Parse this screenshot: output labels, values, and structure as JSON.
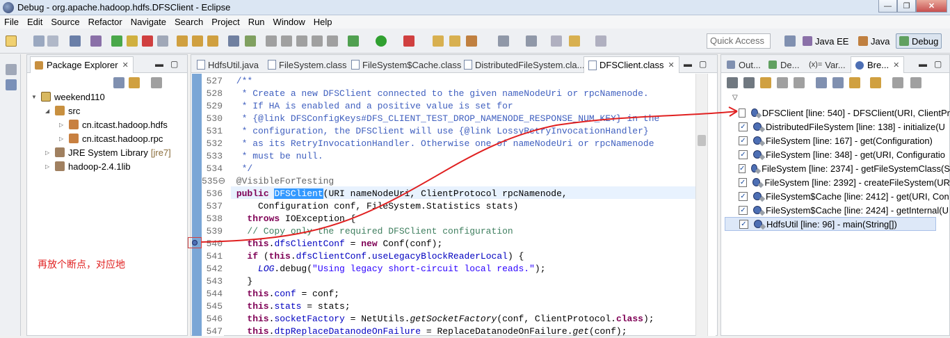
{
  "window": {
    "title": "Debug - org.apache.hadoop.hdfs.DFSClient - Eclipse",
    "minimize": "—",
    "maximize": "❐",
    "close": "✕"
  },
  "menu": [
    "File",
    "Edit",
    "Source",
    "Refactor",
    "Navigate",
    "Search",
    "Project",
    "Run",
    "Window",
    "Help"
  ],
  "quick_access": "Quick Access",
  "perspectives": [
    {
      "label": "Java EE"
    },
    {
      "label": "Java"
    },
    {
      "label": "Debug"
    }
  ],
  "package_explorer": {
    "tab_label": "Package Explorer",
    "close": "✕",
    "tree": [
      {
        "label": "weekend110",
        "expander": "▼"
      },
      {
        "label": "src",
        "expander": "◢"
      },
      {
        "label": "cn.itcast.hadoop.hdfs",
        "expander": "▷"
      },
      {
        "label": "cn.itcast.hadoop.rpc",
        "expander": "▷"
      },
      {
        "label": "JRE System Library",
        "decoration": "[jre7]",
        "expander": "▷"
      },
      {
        "label": "hadoop-2.4.1lib",
        "expander": "▷"
      }
    ]
  },
  "editor": {
    "tabs": [
      {
        "label": "HdfsUtil.java"
      },
      {
        "label": "FileSystem.class"
      },
      {
        "label": "FileSystem$Cache.class"
      },
      {
        "label": "DistributedFileSystem.cla..."
      },
      {
        "label": "DFSClient.class",
        "close": "✕"
      }
    ],
    "lines": [
      {
        "num": "527",
        "segments": [
          {
            "t": " /**",
            "c": "cm"
          }
        ]
      },
      {
        "num": "528",
        "segments": [
          {
            "t": "  * Create a new DFSClient connected to the given nameNodeUri or rpcNamenode.",
            "c": "cm"
          }
        ]
      },
      {
        "num": "529",
        "segments": [
          {
            "t": "  * If HA is enabled and a positive value is set for",
            "c": "cm"
          }
        ]
      },
      {
        "num": "530",
        "segments": [
          {
            "t": "  * {@link DFSConfigKeys#DFS_CLIENT_TEST_DROP_NAMENODE_RESPONSE_NUM_KEY} in the",
            "c": "cm"
          }
        ]
      },
      {
        "num": "531",
        "segments": [
          {
            "t": "  * configuration, the DFSClient will use {@link LossyRetryInvocationHandler}",
            "c": "cm"
          }
        ]
      },
      {
        "num": "532",
        "segments": [
          {
            "t": "  * as its RetryInvocationHandler. Otherwise one of nameNodeUri or rpcNamenode",
            "c": "cm"
          }
        ]
      },
      {
        "num": "533",
        "segments": [
          {
            "t": "  * must be null.",
            "c": "cm"
          }
        ]
      },
      {
        "num": "534",
        "segments": [
          {
            "t": "  */",
            "c": "cm"
          }
        ]
      },
      {
        "num": "535⊖",
        "segments": [
          {
            "t": " @VisibleForTesting",
            "c": "ann"
          }
        ]
      },
      {
        "num": "536",
        "segments": [
          {
            "t": " ",
            "c": ""
          },
          {
            "t": "public",
            "c": "kw"
          },
          {
            "t": " ",
            "c": ""
          },
          {
            "t": "DFSClient",
            "c": "sel"
          },
          {
            "t": "(URI nameNodeUri, ClientProtocol rpcNamenode,",
            "c": ""
          }
        ]
      },
      {
        "num": "537",
        "segments": [
          {
            "t": "     Configuration conf, FileSystem.Statistics stats)",
            "c": ""
          }
        ]
      },
      {
        "num": "538",
        "segments": [
          {
            "t": "   ",
            "c": ""
          },
          {
            "t": "throws",
            "c": "kw"
          },
          {
            "t": " IOException {",
            "c": ""
          }
        ]
      },
      {
        "num": "539",
        "segments": [
          {
            "t": "   // Copy only the required DFSClient configuration",
            "c": "cmg"
          }
        ]
      },
      {
        "num": "540",
        "segments": [
          {
            "t": "   ",
            "c": ""
          },
          {
            "t": "this",
            "c": "kw"
          },
          {
            "t": ".",
            "c": ""
          },
          {
            "t": "dfsClientConf",
            "c": "fld"
          },
          {
            "t": " = ",
            "c": ""
          },
          {
            "t": "new",
            "c": "kw"
          },
          {
            "t": " Conf(conf);",
            "c": ""
          }
        ]
      },
      {
        "num": "541",
        "segments": [
          {
            "t": "   ",
            "c": ""
          },
          {
            "t": "if",
            "c": "kw"
          },
          {
            "t": " (",
            "c": ""
          },
          {
            "t": "this",
            "c": "kw"
          },
          {
            "t": ".",
            "c": ""
          },
          {
            "t": "dfsClientConf",
            "c": "fld"
          },
          {
            "t": ".",
            "c": ""
          },
          {
            "t": "useLegacyBlockReaderLocal",
            "c": "fld"
          },
          {
            "t": ") {",
            "c": ""
          }
        ]
      },
      {
        "num": "542",
        "segments": [
          {
            "t": "     ",
            "c": ""
          },
          {
            "t": "LOG",
            "c": "fld it"
          },
          {
            "t": ".debug(",
            "c": ""
          },
          {
            "t": "\"Using legacy short-circuit local reads.\"",
            "c": "str"
          },
          {
            "t": ");",
            "c": ""
          }
        ]
      },
      {
        "num": "543",
        "segments": [
          {
            "t": "   }",
            "c": ""
          }
        ]
      },
      {
        "num": "544",
        "segments": [
          {
            "t": "   ",
            "c": ""
          },
          {
            "t": "this",
            "c": "kw"
          },
          {
            "t": ".",
            "c": ""
          },
          {
            "t": "conf",
            "c": "fld"
          },
          {
            "t": " = conf;",
            "c": ""
          }
        ]
      },
      {
        "num": "545",
        "segments": [
          {
            "t": "   ",
            "c": ""
          },
          {
            "t": "this",
            "c": "kw"
          },
          {
            "t": ".",
            "c": ""
          },
          {
            "t": "stats",
            "c": "fld"
          },
          {
            "t": " = stats;",
            "c": ""
          }
        ]
      },
      {
        "num": "546",
        "segments": [
          {
            "t": "   ",
            "c": ""
          },
          {
            "t": "this",
            "c": "kw"
          },
          {
            "t": ".",
            "c": ""
          },
          {
            "t": "socketFactory",
            "c": "fld"
          },
          {
            "t": " = NetUtils.",
            "c": ""
          },
          {
            "t": "getSocketFactory",
            "c": "it"
          },
          {
            "t": "(conf, ClientProtocol.",
            "c": ""
          },
          {
            "t": "class",
            "c": "kw"
          },
          {
            "t": ");",
            "c": ""
          }
        ]
      },
      {
        "num": "547",
        "segments": [
          {
            "t": "   ",
            "c": ""
          },
          {
            "t": "this",
            "c": "kw"
          },
          {
            "t": ".",
            "c": ""
          },
          {
            "t": "dtpReplaceDatanodeOnFailure",
            "c": "fld"
          },
          {
            "t": " = ReplaceDatanodeOnFailure.",
            "c": ""
          },
          {
            "t": "get",
            "c": "it"
          },
          {
            "t": "(conf);",
            "c": ""
          }
        ]
      }
    ]
  },
  "annotation": {
    "text": "再放个断点，对应地",
    "color": "#e02020"
  },
  "right_panel": {
    "tabs": [
      {
        "label": "Out..."
      },
      {
        "label": "De..."
      },
      {
        "label": "Var..."
      },
      {
        "label": "Bre...",
        "close": "✕"
      }
    ],
    "breakpoints": [
      {
        "label": "DFSClient [line: 540] - DFSClient(URI, ClientPr",
        "checked": false
      },
      {
        "label": "DistributedFileSystem [line: 138] - initialize(U",
        "checked": true
      },
      {
        "label": "FileSystem [line: 167] - get(Configuration)",
        "checked": true
      },
      {
        "label": "FileSystem [line: 348] - get(URI, Configuratio",
        "checked": true
      },
      {
        "label": "FileSystem [line: 2374] - getFileSystemClass(S",
        "checked": true
      },
      {
        "label": "FileSystem [line: 2392] - createFileSystem(UR",
        "checked": true
      },
      {
        "label": "FileSystem$Cache [line: 2412] - get(URI, Con",
        "checked": true
      },
      {
        "label": "FileSystem$Cache [line: 2424] - getInternal(U",
        "checked": true
      },
      {
        "label": "HdfsUtil [line: 96] - main(String[])",
        "checked": true,
        "selected": true
      }
    ]
  },
  "colors": {
    "selection": "#3399ff",
    "arrow": "#e02020",
    "gutter": "#7aa6d6"
  }
}
